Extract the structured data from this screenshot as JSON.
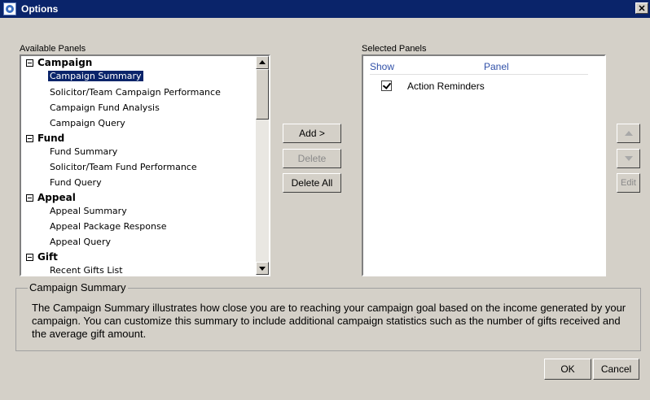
{
  "window": {
    "title": "Options",
    "close_glyph": "✕"
  },
  "available": {
    "label": "Available Panels",
    "tree": [
      {
        "category": "Campaign",
        "items": [
          "Campaign Summary",
          "Solicitor/Team Campaign Performance",
          "Campaign Fund Analysis",
          "Campaign Query"
        ]
      },
      {
        "category": "Fund",
        "items": [
          "Fund Summary",
          "Solicitor/Team Fund Performance",
          "Fund Query"
        ]
      },
      {
        "category": "Appeal",
        "items": [
          "Appeal Summary",
          "Appeal Package Response",
          "Appeal Query"
        ]
      },
      {
        "category": "Gift",
        "items": [
          "Recent Gifts List"
        ]
      }
    ],
    "selected_item": "Campaign Summary"
  },
  "buttons": {
    "add": "Add >",
    "delete": "Delete",
    "delete_all": "Delete All",
    "edit": "Edit",
    "ok": "OK",
    "cancel": "Cancel"
  },
  "selected": {
    "label": "Selected Panels",
    "columns": {
      "show": "Show",
      "panel": "Panel"
    },
    "rows": [
      {
        "checked": true,
        "name": "Action Reminders"
      }
    ]
  },
  "description": {
    "title": "Campaign Summary",
    "text": "The Campaign Summary illustrates how close you are to reaching your campaign goal based on the income generated by your campaign. You can customize this summary to include additional campaign statistics such as the number of gifts received and the average gift amount."
  },
  "icons": {
    "title_icon": "app-globe-icon",
    "collapse": "minus-box-icon",
    "move_up": "move-up-icon",
    "move_down": "move-down-icon",
    "scroll_up": "scroll-up-arrow-icon",
    "scroll_down": "scroll-down-arrow-icon",
    "checkbox": "checkbox-checked-icon"
  },
  "colors": {
    "titlebar": "#0a246a",
    "dialog_bg": "#d4d0c8",
    "selection": "#0a246a",
    "header_text": "#3050a8",
    "disabled_text": "#8a8a8a"
  }
}
